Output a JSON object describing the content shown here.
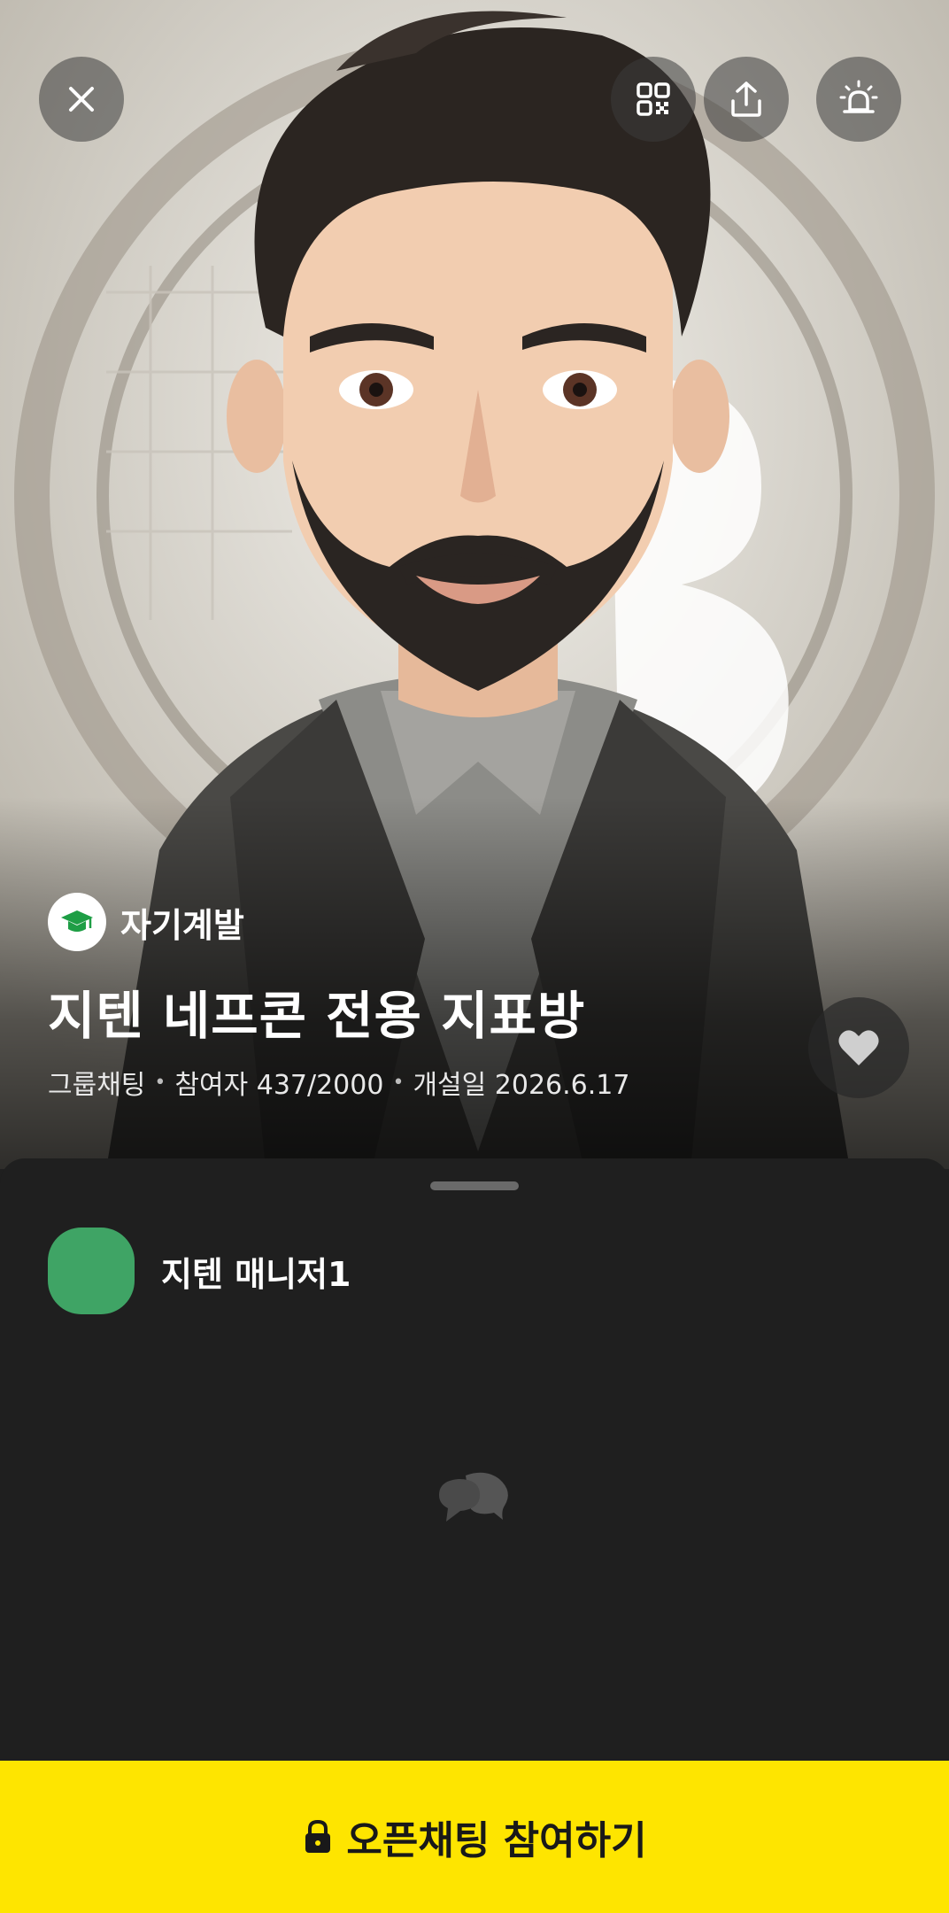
{
  "header": {
    "close_icon": "close-icon",
    "qr_icon": "qr-code-icon",
    "share_icon": "share-icon",
    "report_icon": "siren-icon"
  },
  "room": {
    "category": "자기계발",
    "category_icon": "graduation-cap-icon",
    "title": "지텐 네프콘 전용 지표방",
    "type": "그룹채팅",
    "participants": "참여자 437/2000",
    "opened": "개설일 2026.6.17",
    "like_icon": "heart-icon"
  },
  "host": {
    "name": "지텐 매니저1",
    "avatar_color": "#3fa465"
  },
  "empty_state_icon": "chat-bubbles-icon",
  "join": {
    "label": "오픈채팅 참여하기",
    "icon": "lock-icon",
    "color": "#fee500"
  }
}
